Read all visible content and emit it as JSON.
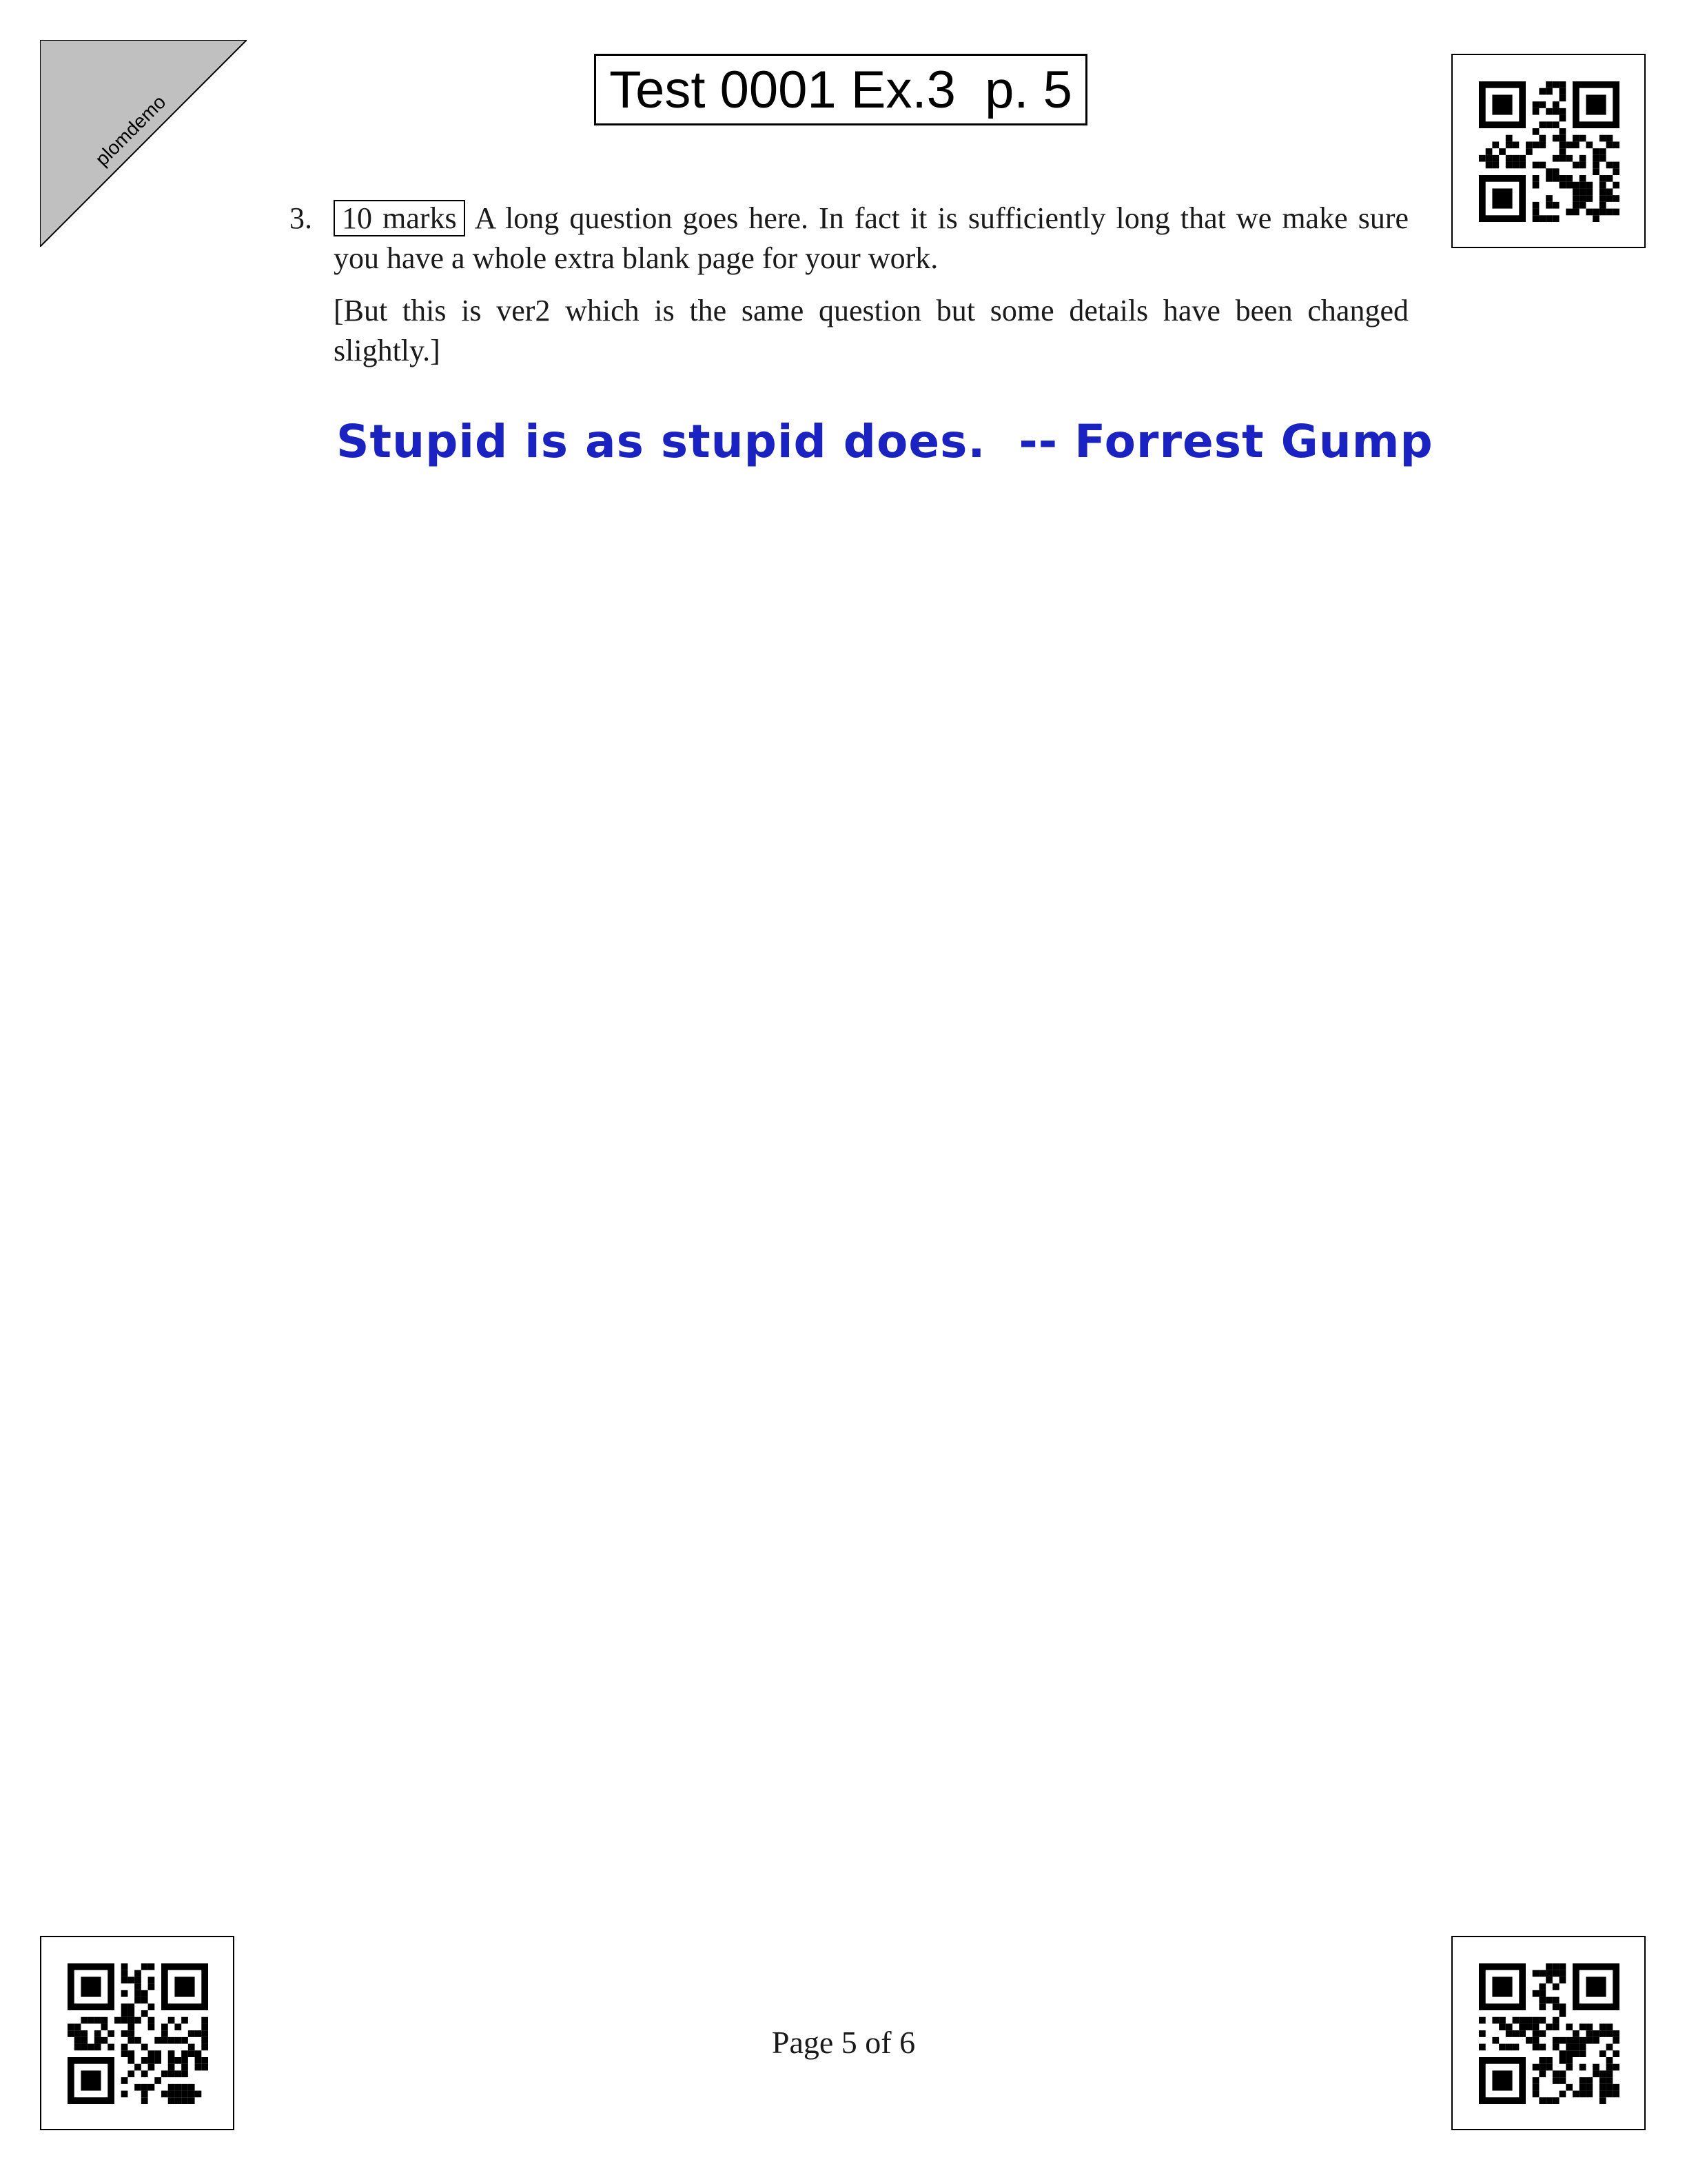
{
  "stamp": {
    "text": "plomdemo"
  },
  "header": {
    "title": "Test 0001 Ex.3  p. 5"
  },
  "question": {
    "number": "3.",
    "marks": "10 marks",
    "text": "A long question goes here. In fact it is sufficiently long that we make sure you have a whole extra blank page for your work.",
    "note": "[But this is ver2 which is the same question but some details have been changed slightly.]"
  },
  "annotation": {
    "text": "Stupid is as stupid does.  -- Forrest Gump",
    "color": "#1a23c2"
  },
  "footer": {
    "page_label": "Page 5 of 6"
  },
  "icons": {
    "corner_codes": [
      "qr-code-icon",
      "qr-code-icon",
      "qr-code-icon"
    ]
  }
}
